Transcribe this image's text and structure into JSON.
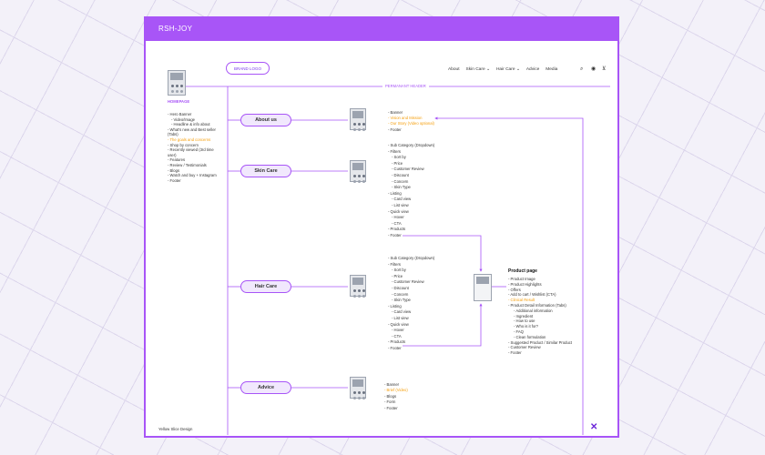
{
  "window": {
    "title": "RSH-JOY"
  },
  "header": {
    "brand_logo": "BRAND LOGO",
    "nav": [
      "About",
      "Skin Care ⌄",
      "Hair Care ⌄",
      "Advice",
      "Media"
    ],
    "icons": [
      "search-icon",
      "account-icon",
      "cart-icon"
    ],
    "permanent_label": "PERMANANT HEADER"
  },
  "homepage": {
    "label": "HOMEPAGE",
    "items": [
      {
        "text": "- Hero Banner",
        "accent": false
      },
      {
        "text": "- Video/Image",
        "accent": false
      },
      {
        "text": "- Headline & info about",
        "accent": false
      },
      {
        "text": "- What's new and Best seller",
        "accent": false
      },
      {
        "text": "(Tabs)",
        "accent": false
      },
      {
        "text": "- The goals and concerns",
        "accent": true
      },
      {
        "text": "- Shop by concern",
        "accent": false
      },
      {
        "text": "- Recently viewed (3rd time",
        "accent": false
      },
      {
        "text": "user)",
        "accent": false
      },
      {
        "text": "- Features",
        "accent": false
      },
      {
        "text": "- Review / Testimonials",
        "accent": false
      },
      {
        "text": "- Blogs",
        "accent": false
      },
      {
        "text": "- Watch and buy + Instagram",
        "accent": false
      },
      {
        "text": "- Footer",
        "accent": false
      }
    ]
  },
  "sections": {
    "about": {
      "label": "About us",
      "items": [
        {
          "text": "- Banner",
          "accent": false
        },
        {
          "text": "- Vision and Mission",
          "accent": true
        },
        {
          "text": "- Our Story (Video optional)",
          "accent": true
        },
        {
          "text": "- Footer",
          "accent": false
        }
      ]
    },
    "skin": {
      "label": "Skin Care",
      "items": [
        {
          "text": "- Sub Category (Dropdown)",
          "accent": false
        },
        {
          "text": "- Filters",
          "accent": false
        },
        {
          "text": "- Sort by",
          "accent": false
        },
        {
          "text": "- Price",
          "accent": false
        },
        {
          "text": "- Customer Review",
          "accent": false
        },
        {
          "text": "- Discount",
          "accent": false
        },
        {
          "text": "- Concern",
          "accent": false
        },
        {
          "text": "- Skin Type",
          "accent": false
        },
        {
          "text": "- Listing",
          "accent": false
        },
        {
          "text": "- Card view",
          "accent": false
        },
        {
          "text": "- List view",
          "accent": false
        },
        {
          "text": "- Quick view",
          "accent": false
        },
        {
          "text": "- Hover",
          "accent": false
        },
        {
          "text": "- CTA",
          "accent": false
        },
        {
          "text": "- Products",
          "accent": false
        },
        {
          "text": "- Footer",
          "accent": false
        }
      ]
    },
    "hair": {
      "label": "Hair Care",
      "items": [
        {
          "text": "- Sub Category (Dropdown)",
          "accent": false
        },
        {
          "text": "- Filters",
          "accent": false
        },
        {
          "text": "- Sort by",
          "accent": false
        },
        {
          "text": "- Price",
          "accent": false
        },
        {
          "text": "- Customer Review",
          "accent": false
        },
        {
          "text": "- Discount",
          "accent": false
        },
        {
          "text": "- Concern",
          "accent": false
        },
        {
          "text": "- Skin Type",
          "accent": false
        },
        {
          "text": "- Listing",
          "accent": false
        },
        {
          "text": "- Card view",
          "accent": false
        },
        {
          "text": "- List view",
          "accent": false
        },
        {
          "text": "- Quick view",
          "accent": false
        },
        {
          "text": "- Hover",
          "accent": false
        },
        {
          "text": "- CTA",
          "accent": false
        },
        {
          "text": "- Products",
          "accent": false
        },
        {
          "text": "- Footer",
          "accent": false
        }
      ]
    },
    "advice": {
      "label": "Advice",
      "items": [
        {
          "text": "- Banner",
          "accent": false
        },
        {
          "text": "- Brief (Video)",
          "accent": true
        },
        {
          "text": "- Blogs",
          "accent": false
        },
        {
          "text": "- Form",
          "accent": false
        },
        {
          "text": "- Footer",
          "accent": false
        }
      ]
    }
  },
  "product_page": {
    "title": "Product page",
    "items": [
      {
        "text": "- Product Image",
        "accent": false
      },
      {
        "text": "- Product Highlights",
        "accent": false
      },
      {
        "text": "- Offers",
        "accent": false
      },
      {
        "text": "- Add to cart / Wishlist (CTA)",
        "accent": false
      },
      {
        "text": "- Clinical Result",
        "accent": true
      },
      {
        "text": "- Product Detail Information (Tabs)",
        "accent": false
      },
      {
        "text": "- Additional information",
        "accent": false
      },
      {
        "text": "- Ingredient",
        "accent": false
      },
      {
        "text": "- How to use",
        "accent": false
      },
      {
        "text": "- Who is it for?",
        "accent": false
      },
      {
        "text": "- FAQ",
        "accent": false
      },
      {
        "text": "- Clean formulation",
        "accent": false
      },
      {
        "text": "- Suggested Product / Similar Product",
        "accent": false
      },
      {
        "text": "- Customer Review",
        "accent": false
      },
      {
        "text": "- Footer",
        "accent": false
      }
    ]
  },
  "footer_credit": "Yellow Slice Design",
  "colors": {
    "accent": "#a855f7",
    "highlight": "#f59e0b",
    "background": "#f3f1f9"
  }
}
